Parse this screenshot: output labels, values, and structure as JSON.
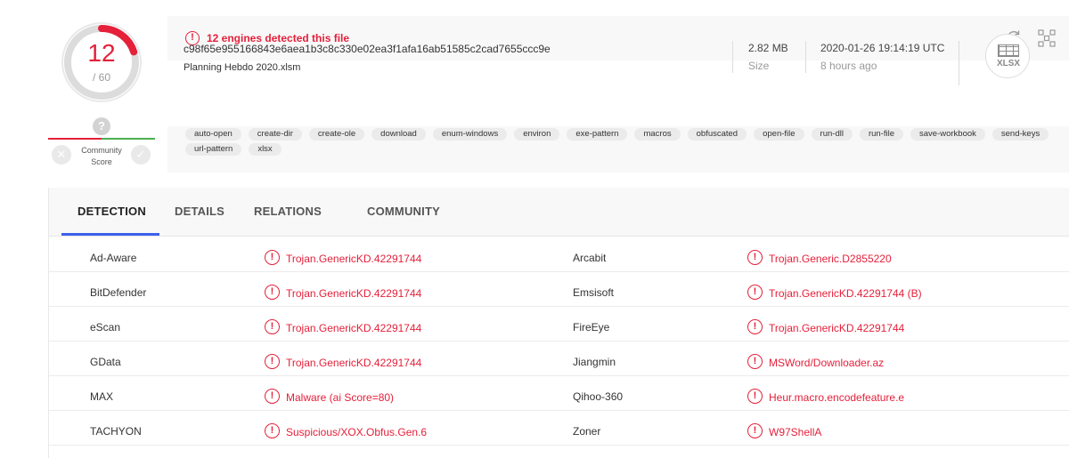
{
  "score": {
    "detected": "12",
    "total": "/ 60",
    "ratio": 0.2,
    "accent": "#e5203a"
  },
  "community": {
    "question": "?",
    "label_line1": "Community",
    "label_line2": "Score",
    "harmless_icon": "x-icon",
    "malicious_icon": "check-icon"
  },
  "alert": {
    "icon": "exclamation-circle-icon",
    "text": "12 engines detected this file"
  },
  "toolbar": {
    "reanalyze_icon": "refresh-icon",
    "similar_icon": "similar-grid-icon"
  },
  "file": {
    "hash": "c98f65e955166843e6aea1b3c8c330e02ea3f1afa16ab51585c2cad7655ccc9e",
    "name": "Planning Hebdo 2020.xlsm",
    "size_value": "2.82 MB",
    "size_label": "Size",
    "date_value": "2020-01-26 19:14:19 UTC",
    "date_relative": "8 hours ago",
    "type_icon": "xlsx-file-icon",
    "type_label": "XLSX"
  },
  "tags": [
    "auto-open",
    "create-dir",
    "create-ole",
    "download",
    "enum-windows",
    "environ",
    "exe-pattern",
    "macros",
    "obfuscated",
    "open-file",
    "run-dll",
    "run-file",
    "save-workbook",
    "send-keys",
    "url-pattern",
    "xlsx"
  ],
  "tabs": {
    "detection": "DETECTION",
    "details": "DETAILS",
    "relations": "RELATIONS",
    "community": "COMMUNITY",
    "active_color": "#3b61ea"
  },
  "detections": [
    {
      "engine_a": "Ad-Aware",
      "result_a": "Trojan.GenericKD.42291744",
      "engine_b": "Arcabit",
      "result_b": "Trojan.Generic.D2855220"
    },
    {
      "engine_a": "BitDefender",
      "result_a": "Trojan.GenericKD.42291744",
      "engine_b": "Emsisoft",
      "result_b": "Trojan.GenericKD.42291744 (B)"
    },
    {
      "engine_a": "eScan",
      "result_a": "Trojan.GenericKD.42291744",
      "engine_b": "FireEye",
      "result_b": "Trojan.GenericKD.42291744"
    },
    {
      "engine_a": "GData",
      "result_a": "Trojan.GenericKD.42291744",
      "engine_b": "Jiangmin",
      "result_b": "MSWord/Downloader.az"
    },
    {
      "engine_a": "MAX",
      "result_a": "Malware (ai Score=80)",
      "engine_b": "Qihoo-360",
      "result_b": "Heur.macro.encodefeature.e"
    },
    {
      "engine_a": "TACHYON",
      "result_a": "Suspicious/XOX.Obfus.Gen.6",
      "engine_b": "Zoner",
      "result_b": "W97ShellA"
    }
  ]
}
